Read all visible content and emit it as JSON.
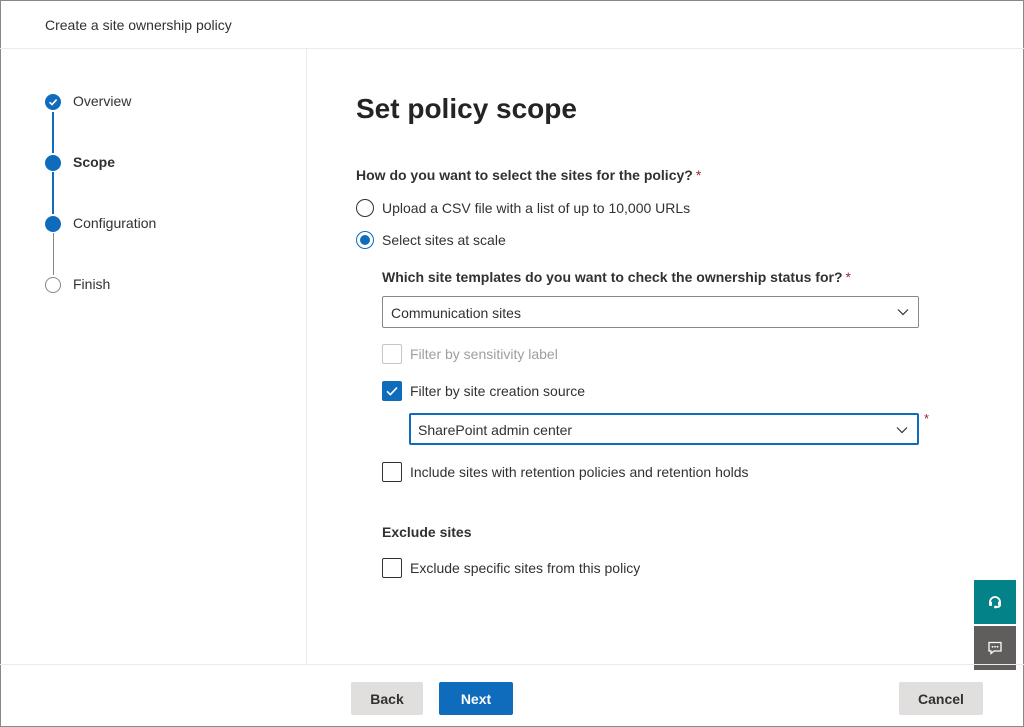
{
  "header": {
    "title": "Create a site ownership policy"
  },
  "steps": [
    {
      "label": "Overview",
      "state": "completed"
    },
    {
      "label": "Scope",
      "state": "current"
    },
    {
      "label": "Configuration",
      "state": "upcoming"
    },
    {
      "label": "Finish",
      "state": "not-started"
    }
  ],
  "main": {
    "title": "Set policy scope",
    "question": "How do you want to select the sites for the policy?",
    "required_mark": "*",
    "radio_options": [
      {
        "label": "Upload a CSV file with a list of up to 10,000 URLs",
        "selected": false
      },
      {
        "label": "Select sites at scale",
        "selected": true
      }
    ],
    "template_question": "Which site templates do you want to check the ownership status for?",
    "template_dropdown": {
      "value": "Communication sites"
    },
    "checkboxes": {
      "sensitivity": {
        "label": "Filter by sensitivity label",
        "checked": false,
        "disabled": true
      },
      "creation_source": {
        "label": "Filter by site creation source",
        "checked": true
      },
      "retention": {
        "label": "Include sites with retention policies and retention holds",
        "checked": false
      }
    },
    "source_dropdown": {
      "value": "SharePoint admin center"
    },
    "exclude_section": {
      "title": "Exclude sites",
      "checkbox_label": "Exclude specific sites from this policy",
      "checked": false
    }
  },
  "footer": {
    "back_label": "Back",
    "next_label": "Next",
    "cancel_label": "Cancel"
  },
  "side_buttons": [
    {
      "icon": "headset-icon",
      "color": "#038387"
    },
    {
      "icon": "feedback-icon",
      "color": "#605e5c"
    }
  ],
  "colors": {
    "accent": "#0f6cbd",
    "required": "#a4262c",
    "help_button": "#038387",
    "feedback_button": "#605e5c"
  }
}
